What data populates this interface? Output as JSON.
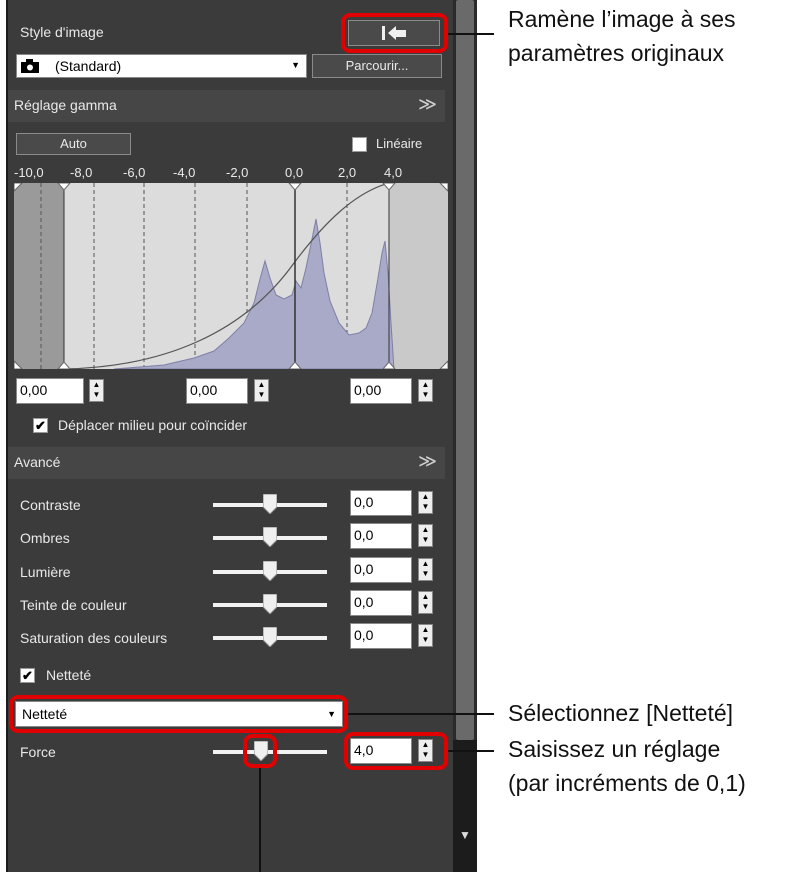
{
  "style": {
    "header": "Style d'image",
    "combo_value": "(Standard)",
    "browse_label": "Parcourir...",
    "reset_icon": "reset-to-original-icon"
  },
  "gamma": {
    "header": "Réglage gamma",
    "auto_label": "Auto",
    "linear_label": "Linéaire",
    "linear_checked": false,
    "axis_ticks": [
      "-10,0",
      "-8,0",
      "-6,0",
      "-4,0",
      "-2,0",
      "0,0",
      "2,0",
      "4,0"
    ],
    "input_left": "0,00",
    "input_mid": "0,00",
    "input_right": "0,00",
    "move_mid_label": "Déplacer milieu pour coïncider",
    "move_mid_checked": true
  },
  "advanced": {
    "header": "Avancé",
    "rows": [
      {
        "label": "Contraste",
        "value": "0,0"
      },
      {
        "label": "Ombres",
        "value": "0,0"
      },
      {
        "label": "Lumière",
        "value": "0,0"
      },
      {
        "label": "Teinte de couleur",
        "value": "0,0"
      },
      {
        "label": "Saturation des couleurs",
        "value": "0,0"
      }
    ],
    "sharpness_label": "Netteté",
    "sharpness_checked": true,
    "sharpness_combo": "Netteté",
    "force_label": "Force",
    "force_value": "4,0"
  },
  "annotations": {
    "reset_line1": "Ramène l’image à ses",
    "reset_line2": "paramètres originaux",
    "select": "Sélectionnez [Netteté]",
    "enter_line1": "Saisissez un réglage",
    "enter_line2": "(par incréments de 0,1)"
  },
  "colors": {
    "panel_bg": "#3b3b3b",
    "highlight": "#e00000",
    "histogram_fill": "#a9a9c8"
  }
}
